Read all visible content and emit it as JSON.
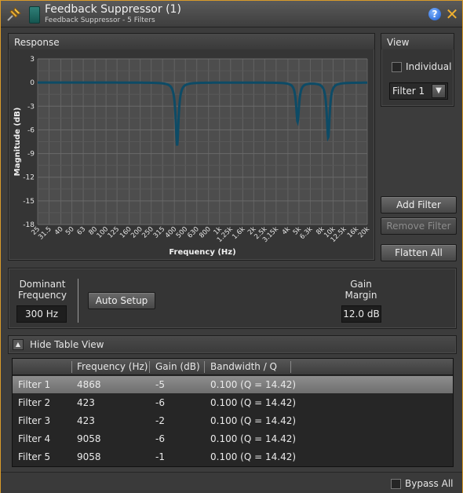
{
  "window": {
    "title": "Feedback Suppressor (1)",
    "subtitle": "Feedback Suppressor - 5 Filters",
    "help_label": "?",
    "close_label": "✕"
  },
  "response": {
    "label": "Response",
    "chart_data": {
      "type": "line",
      "xlabel": "Frequency (Hz)",
      "ylabel": "Magnitude (dB)",
      "xscale": "log",
      "xlim": [
        25,
        20000
      ],
      "ylim": [
        -18,
        3
      ],
      "grid": true,
      "x_ticks": [
        "25",
        "31.5",
        "40",
        "50",
        "63",
        "80",
        "100",
        "125",
        "160",
        "200",
        "250",
        "315",
        "400",
        "500",
        "630",
        "800",
        "1k",
        "1.25k",
        "1.6k",
        "2k",
        "2.5k",
        "3.15k",
        "4k",
        "5k",
        "6.3k",
        "8k",
        "10k",
        "12.5k",
        "16k",
        "20k"
      ],
      "y_ticks": [
        3,
        0,
        -3,
        -6,
        -9,
        -12,
        -15,
        -18
      ],
      "series": [
        {
          "color": "#0d4b66",
          "notches": [
            {
              "freq": 4868,
              "gain": -5,
              "q": 14.42
            },
            {
              "freq": 423,
              "gain": -6,
              "q": 14.42
            },
            {
              "freq": 423,
              "gain": -2,
              "q": 14.42
            },
            {
              "freq": 9058,
              "gain": -6,
              "q": 14.42
            },
            {
              "freq": 9058,
              "gain": -1,
              "q": 14.42
            }
          ]
        }
      ]
    }
  },
  "view": {
    "label": "View",
    "individual_label": "Individual",
    "individual_checked": false,
    "filter_select": "Filter 1",
    "add_filter": "Add Filter",
    "remove_filter": "Remove Filter",
    "flatten_all": "Flatten All"
  },
  "setup": {
    "dominant_label_1": "Dominant",
    "dominant_label_2": "Frequency",
    "dominant_value": "300 Hz",
    "auto_setup": "Auto Setup",
    "gain_label_1": "Gain",
    "gain_label_2": "Margin",
    "gain_value": "12.0 dB"
  },
  "table_view": {
    "toggle_label": "Hide Table View",
    "columns": [
      "",
      "Frequency (Hz)",
      "Gain (dB)",
      "Bandwidth / Q"
    ],
    "rows": [
      {
        "name": "Filter 1",
        "freq": "4868",
        "gain": "-5",
        "bw": "0.100 (Q = 14.42)",
        "selected": true
      },
      {
        "name": "Filter 2",
        "freq": "423",
        "gain": "-6",
        "bw": "0.100 (Q = 14.42)"
      },
      {
        "name": "Filter 3",
        "freq": "423",
        "gain": "-2",
        "bw": "0.100 (Q = 14.42)"
      },
      {
        "name": "Filter 4",
        "freq": "9058",
        "gain": "-6",
        "bw": "0.100 (Q = 14.42)"
      },
      {
        "name": "Filter 5",
        "freq": "9058",
        "gain": "-1",
        "bw": "0.100 (Q = 14.42)"
      }
    ]
  },
  "footer": {
    "bypass_label": "Bypass All",
    "bypass_checked": false
  },
  "colors": {
    "accent_border": "#d89a2a",
    "plot_bg": "#4d4d4d",
    "curve": "#0d4b66"
  }
}
